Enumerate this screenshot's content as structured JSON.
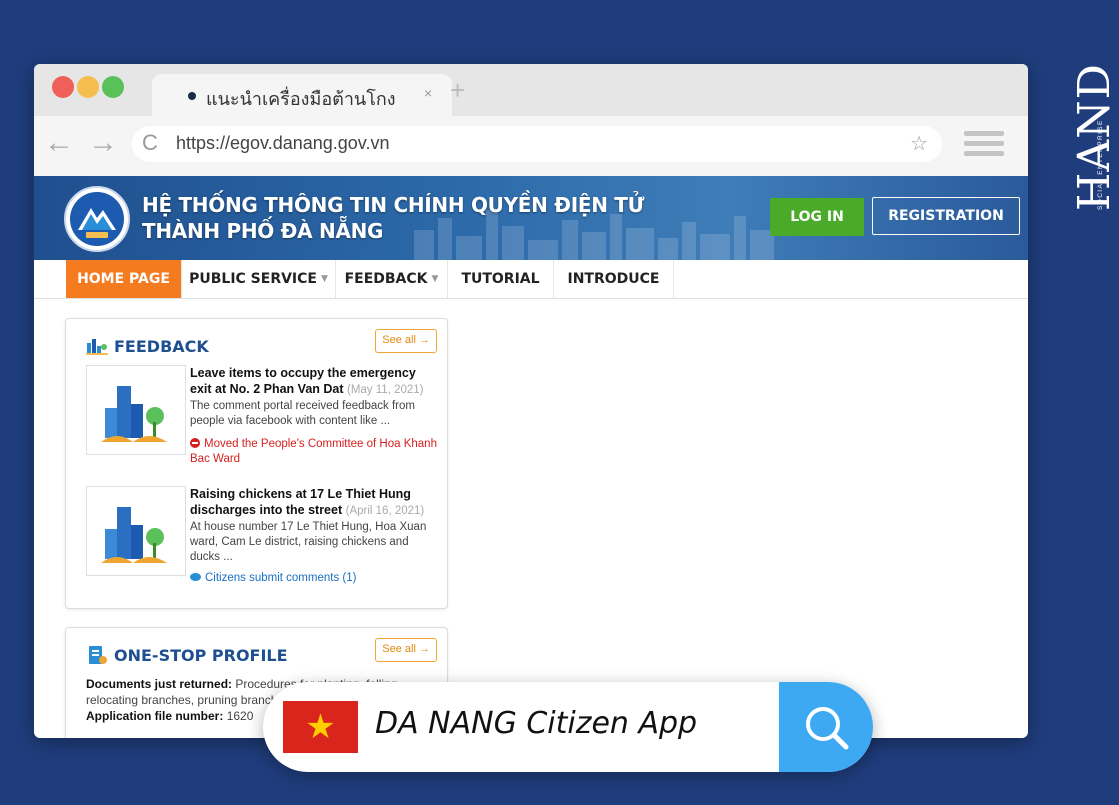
{
  "brand": {
    "name": "HAND",
    "tagline": "SOCIAL ENTERPRISE"
  },
  "browser": {
    "tab_title": "แนะนำเครื่องมือต้านโกง",
    "tab_close": "×",
    "new_tab": "+",
    "url": "https://egov.danang.gov.vn",
    "back": "←",
    "forward": "→",
    "reload": "C",
    "bookmark": "☆"
  },
  "site": {
    "title_line1": "HỆ THỐNG THÔNG TIN CHÍNH QUYỀN ĐIỆN TỬ",
    "title_line2": "THÀNH PHỐ ĐÀ NẴNG",
    "login": "LOG IN",
    "registration": "REGISTRATION"
  },
  "nav": {
    "items": [
      {
        "label": "HOME PAGE",
        "active": true
      },
      {
        "label": "PUBLIC SERVICE",
        "caret": true
      },
      {
        "label": "FEEDBACK",
        "caret": true
      },
      {
        "label": "TUTORIAL"
      },
      {
        "label": "INTRODUCE"
      }
    ],
    "caret_char": "▼"
  },
  "feedback_panel": {
    "title": "FEEDBACK",
    "see_all": "See all →",
    "items": [
      {
        "title": "Leave items to occupy the emergency exit at No. 2 Phan Van Dat",
        "date": "(May 11, 2021)",
        "desc": "The comment portal received feedback from people via facebook with content like ...",
        "status": "Moved the People's Committee of Hoa Khanh Bac Ward"
      },
      {
        "title": "Raising chickens at 17 Le Thiet Hung discharges into the street",
        "date": "(April 16, 2021)",
        "desc": "At house number 17 Le Thiet Hung, Hoa Xuan ward, Cam Le district, raising chickens and ducks ...",
        "status": "Citizens submit comments (1)"
      }
    ]
  },
  "profile_panel": {
    "title": "ONE-STOP PROFILE",
    "see_all": "See all →",
    "docs_label": "Documents just returned:",
    "docs_value": "Procedures for planting, felling, relocating branches, pruning branches, ... roots",
    "app_label": "Application file number:",
    "app_value": "1620"
  },
  "search_banner": {
    "text": "DA NANG Citizen App",
    "flag_star": "★"
  },
  "colors": {
    "background": "#1f3d7c",
    "nav_active": "#f47b20",
    "login_button": "#4aab2a",
    "search_button": "#3da9f2",
    "status_red": "#d62020",
    "status_blue": "#1a6fc2"
  }
}
